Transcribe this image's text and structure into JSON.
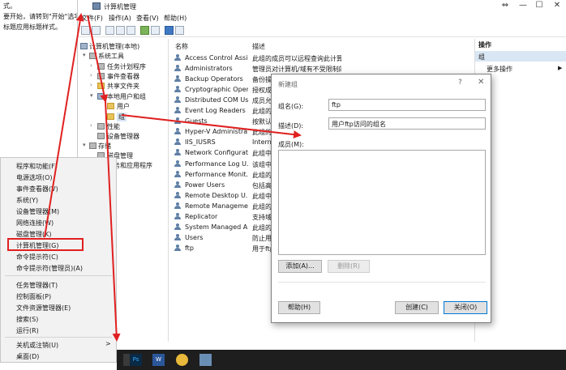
{
  "doc_snippet": {
    "line1": "式。",
    "line2": "要开始，请转到\"开始\"选项",
    "line3": "标题应用标题样式。"
  },
  "window": {
    "title": "计算机管理",
    "controls": {
      "restore": "⇔",
      "minimize": "—",
      "maximize": "☐",
      "close": "✕"
    },
    "menu": [
      "文件(F)",
      "操作(A)",
      "查看(V)",
      "帮助(H)"
    ]
  },
  "tree": {
    "root": "计算机管理(本地)",
    "system_tools": "系统工具",
    "task_scheduler": "任务计划程序",
    "event_viewer": "事件查看器",
    "shared_folders": "共享文件夹",
    "local_users": "本地用户和组",
    "users": "用户",
    "groups": "组",
    "performance": "性能",
    "device_manager": "设备管理器",
    "storage": "存储",
    "disk_management": "磁盘管理",
    "services": "服务和应用程序"
  },
  "list": {
    "col_name": "名称",
    "col_desc": "描述",
    "rows": [
      {
        "name": "Access Control Assi...",
        "desc": "此组的成员可以远程查询此计算..."
      },
      {
        "name": "Administrators",
        "desc": "管理员对计算机/域有不受限制的..."
      },
      {
        "name": "Backup Operators",
        "desc": "备份操作员..."
      },
      {
        "name": "Cryptographic Oper...",
        "desc": "授权成员..."
      },
      {
        "name": "Distributed COM Us...",
        "desc": "成员允..."
      },
      {
        "name": "Event Log Readers",
        "desc": "此组的..."
      },
      {
        "name": "Guests",
        "desc": "按默认..."
      },
      {
        "name": "Hyper-V Administra...",
        "desc": "此组的..."
      },
      {
        "name": "IIS_IUSRS",
        "desc": "Intern..."
      },
      {
        "name": "Network Configurat...",
        "desc": "此组中..."
      },
      {
        "name": "Performance Log U...",
        "desc": "该组中..."
      },
      {
        "name": "Performance Monit...",
        "desc": "此组的..."
      },
      {
        "name": "Power Users",
        "desc": "包括高..."
      },
      {
        "name": "Remote Desktop U...",
        "desc": "此组中..."
      },
      {
        "name": "Remote Manageme...",
        "desc": "此组的..."
      },
      {
        "name": "Replicator",
        "desc": "支持域..."
      },
      {
        "name": "System Managed A...",
        "desc": "此组的..."
      },
      {
        "name": "Users",
        "desc": "防止用..."
      },
      {
        "name": "ftp",
        "desc": "用于ftp..."
      }
    ]
  },
  "actions": {
    "header": "操作",
    "group": "组",
    "more": "更多操作",
    "more_arrow": "▶"
  },
  "dialog": {
    "title": "新建组",
    "help": "?",
    "close": "✕",
    "name_label": "组名(G):",
    "name_value": "ftp",
    "desc_label": "描述(D):",
    "desc_value": "用户ftp访问的组名",
    "members_label": "成员(M):",
    "add_button": "添加(A)...",
    "remove_button": "删除(R)",
    "help_button": "帮助(H)",
    "create_button": "创建(C)",
    "close_button": "关闭(O)"
  },
  "context_menu": {
    "items": [
      "程序和功能(F)",
      "电源选项(O)",
      "事件查看器(V)",
      "系统(Y)",
      "设备管理器(M)",
      "网络连接(W)",
      "磁盘管理(K)",
      "计算机管理(G)",
      "命令提示符(C)",
      "命令提示符(管理员)(A)",
      "任务管理器(T)",
      "控制面板(P)",
      "文件资源管理器(E)",
      "搜索(S)",
      "运行(R)",
      "关机或注销(U)",
      "桌面(D)"
    ],
    "submenu_arrow": ">"
  },
  "taskbar": {
    "ps": "Ps",
    "word": "W"
  },
  "colors": {
    "highlight_box": "#e02020",
    "arrow": "#e02020",
    "selection": "#d9e6f4"
  }
}
